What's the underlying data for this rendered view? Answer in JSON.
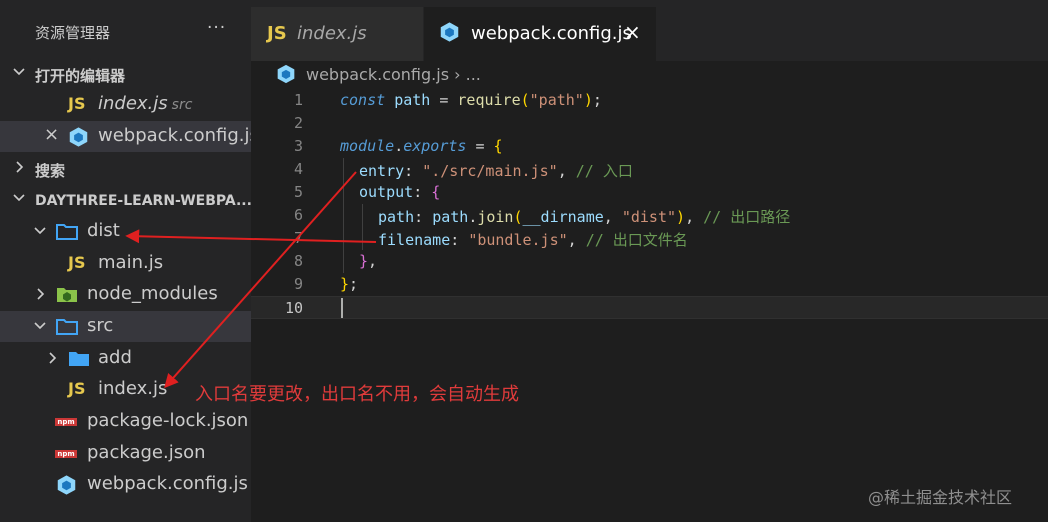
{
  "sidebar": {
    "title": "资源管理器",
    "more": "···",
    "open_editors_label": "打开的编辑器",
    "open_editors": [
      {
        "name": "index.js",
        "hint": "src"
      },
      {
        "name": "webpack.config.js"
      }
    ],
    "search_label": "搜索",
    "project_label": "DAYTHREE-LEARN-WEBPA...",
    "tree": [
      {
        "name": "dist"
      },
      {
        "name": "main.js"
      },
      {
        "name": "node_modules"
      },
      {
        "name": "src"
      },
      {
        "name": "add"
      },
      {
        "name": "index.js"
      },
      {
        "name": "package-lock.json"
      },
      {
        "name": "package.json"
      },
      {
        "name": "webpack.config.js"
      }
    ],
    "close_glyph": "×"
  },
  "tabs": [
    {
      "label": "index.js",
      "icon": "JS"
    },
    {
      "label": "webpack.config.js",
      "close": "×"
    }
  ],
  "breadcrumb": {
    "file": "webpack.config.js",
    "sep": "›",
    "tail": "..."
  },
  "editor": {
    "line_numbers": [
      "1",
      "2",
      "3",
      "4",
      "5",
      "6",
      "7",
      "8",
      "9",
      "10"
    ],
    "tokens": {
      "l1_const": "const",
      "l1_path": "path",
      "l1_eq": " = ",
      "l1_require": "require",
      "l1_open": "(",
      "l1_str": "\"path\"",
      "l1_close": ")",
      "l1_semi": ";",
      "l3_module": "module",
      "l3_dot": ".",
      "l3_exports": "exports",
      "l3_eq": " = ",
      "l3_brace": "{",
      "l4_key": "entry",
      "l4_colon": ": ",
      "l4_str": "\"./src/main.js\"",
      "l4_comma": ", ",
      "l4_cmt": "// 入口",
      "l5_key": "output",
      "l5_colon": ": ",
      "l5_brace": "{",
      "l6_key": "path",
      "l6_colon": ": ",
      "l6_obj": "path",
      "l6_dot": ".",
      "l6_fn": "join",
      "l6_open": "(",
      "l6_arg": "__dirname",
      "l6_comma": ", ",
      "l6_str": "\"dist\"",
      "l6_close": ")",
      "l6_comma2": ", ",
      "l6_cmt": "// 出口路径",
      "l7_key": "filename",
      "l7_colon": ": ",
      "l7_str": "\"bundle.js\"",
      "l7_comma": ", ",
      "l7_cmt": "// 出口文件名",
      "l8_brace": "}",
      "l8_comma": ",",
      "l9_brace": "}",
      "l9_semi": ";"
    }
  },
  "annotation": "入口名要更改，出口名不用，会自动生成",
  "watermark": "@稀土掘金技术社区",
  "colors": {
    "arrow": "#e02020",
    "js": "#e6c84e",
    "folder": "#42a5f5",
    "webpack": "#8ed6fb"
  }
}
